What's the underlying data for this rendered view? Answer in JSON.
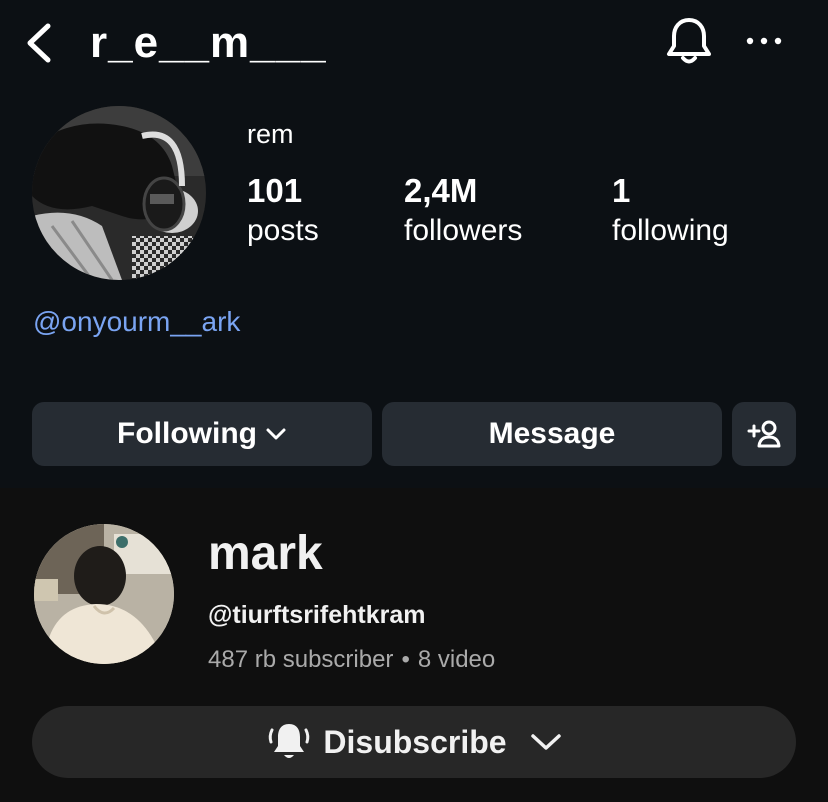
{
  "instagram": {
    "header": {
      "username": "r_e__m___"
    },
    "profile": {
      "display_name": "rem",
      "stats": [
        {
          "value": "101",
          "label": "posts"
        },
        {
          "value": "2,4M",
          "label": "followers"
        },
        {
          "value": "1",
          "label": "following"
        }
      ],
      "mention_link": "@onyourm__ark"
    },
    "actions": {
      "following_label": "Following",
      "message_label": "Message"
    },
    "icons": [
      "back-icon",
      "bell-icon",
      "more-icon",
      "chevron-down-icon",
      "add-user-icon"
    ],
    "colors": {
      "background": "#0c1014",
      "button": "#262c33",
      "link": "#7aa4f2"
    }
  },
  "youtube": {
    "channel": {
      "name": "mark",
      "handle": "@tiurftsrifehtkram",
      "subscribers": "487 rb subscriber",
      "videos": "8 video"
    },
    "subscribe_button": {
      "label": "Disubscribe"
    },
    "icons": [
      "notification-bell-icon",
      "chevron-down-icon"
    ],
    "colors": {
      "background": "#0f0f0f",
      "button": "#272727",
      "secondary_text": "#aaaaaa"
    }
  }
}
